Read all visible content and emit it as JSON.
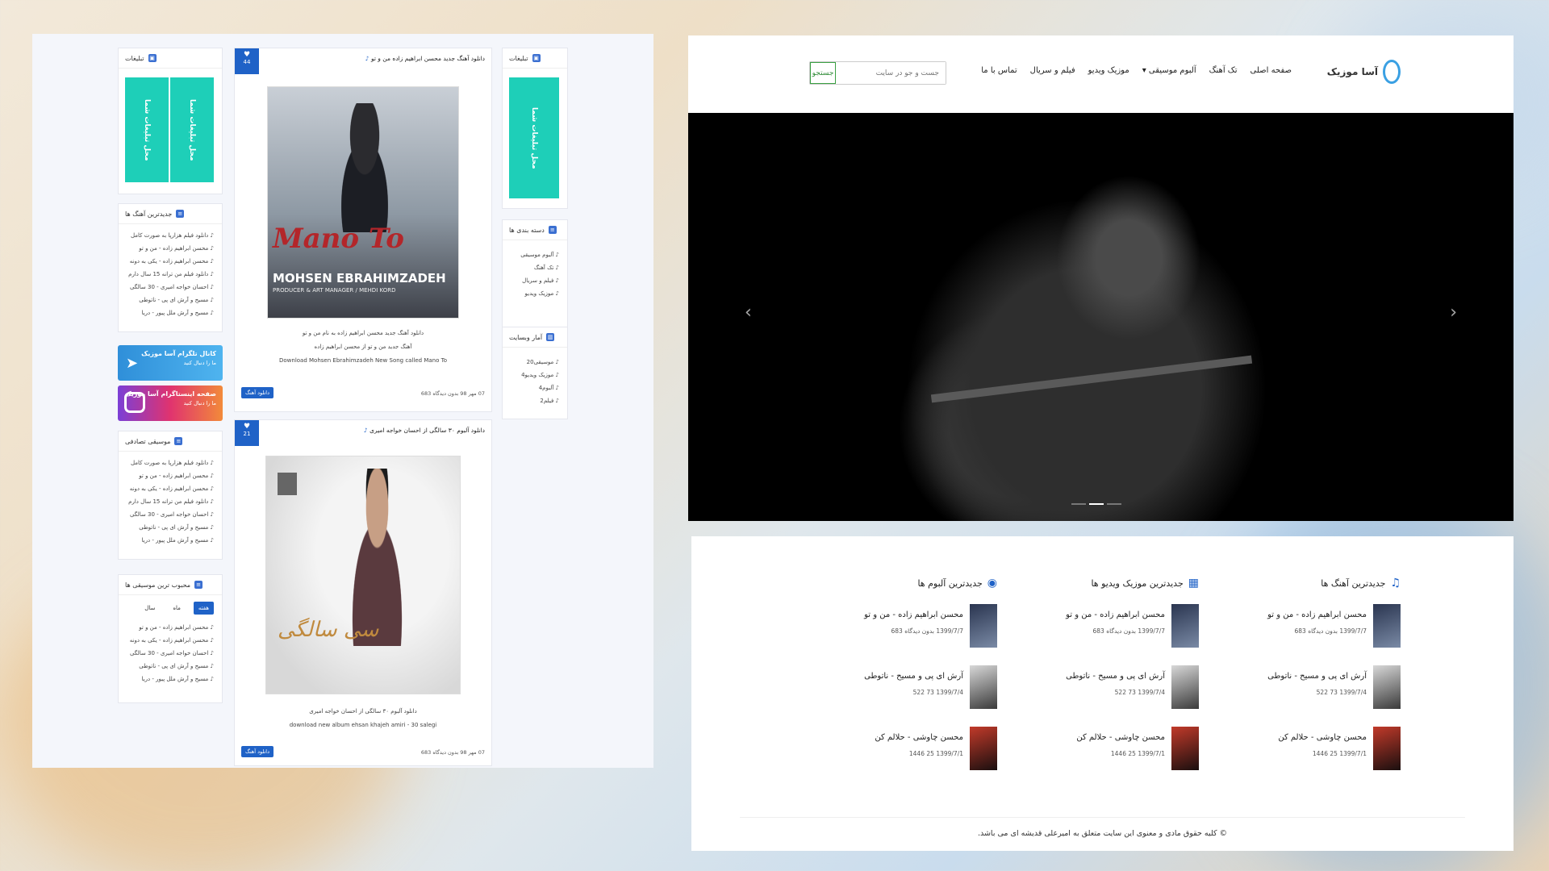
{
  "left_page": {
    "ads_title": "تبلیغات",
    "ad_text": "محل تبلیغات شما",
    "latest_songs_title": "جدیدترین آهنگ ها",
    "latest_songs": [
      "دانلود فیلم هزارپا به صورت کامل",
      "محسن ابراهیم زاده - من و تو",
      "محسن ابراهیم زاده - یکی به دونه",
      "دانلود فیلم من ترانه 15 سال دارم",
      "احسان خواجه امیری - 30 سالگی",
      "مسیح و آرش ای پی - ناتوطی",
      "مسیح و آرش ملل پیور - دریا"
    ],
    "telegram": {
      "title": "کانال تلگرام آسا موزیک",
      "sub": "ما را دنبال کنید"
    },
    "instagram": {
      "title": "صفحه اینستاگرام آسا موزیک",
      "sub": "ما را دنبال کنید"
    },
    "random_title": "موسیقی تصادفی",
    "random_songs": [
      "دانلود فیلم هزارپا به صورت کامل",
      "محسن ابراهیم زاده - من و تو",
      "محسن ابراهیم زاده - یکی به دونه",
      "دانلود فیلم من ترانه 15 سال دارم",
      "احسان خواجه امیری - 30 سالگی",
      "مسیح و آرش ای پی - ناتوطی",
      "مسیح و آرش ملل پیور - دریا"
    ],
    "popular_title": "محبوب ترین موسیقی ها",
    "popular_tabs": [
      "هفته",
      "ماه",
      "سال"
    ],
    "popular_songs": [
      "محسن ابراهیم زاده - من و تو",
      "محسن ابراهیم زاده - یکی به دونه",
      "احسان خواجه امیری - 30 سالگی",
      "مسیح و آرش ای پی - ناتوطی",
      "مسیح و آرش ملل پیور - دریا"
    ],
    "categories_title": "دسته بندی ها",
    "categories": [
      "آلبوم موسیقی",
      "تک آهنگ",
      "فیلم و سریال",
      "موزیک ویدیو"
    ],
    "stats_title": "آمار وبسایت",
    "stats": [
      "موسیقی20",
      "موزیک ویدیو4",
      "آلبوم4",
      "فیلم2"
    ],
    "posts": [
      {
        "likes": "44",
        "title": "دانلود آهنگ جدید محسن ابراهیم زاده من و تو",
        "cover_name": "Mano To",
        "cover_artist": "MOHSEN EBRAHIMZADEH",
        "cover_sub": "PRODUCER & ART MANAGER / MEHDI KORD",
        "desc1": "دانلود آهنگ جدید محسن ابراهیم زاده به نام من و تو",
        "desc2": "آهنگ جدید من و تو از محسن ابراهیم زاده",
        "desc3": "Download Mohsen Ebrahimzadeh New Song called Mano To",
        "btn": "دانلود آهنگ",
        "meta": "07 مهر 98  بدون دیدگاه  683"
      },
      {
        "likes": "21",
        "title": "دانلود آلبوم ۳۰ سالگی از احسان خواجه امیری",
        "cover_name": "سی سالگی",
        "desc1": "دانلود آلبوم ۳۰ سالگی از احسان خواجه امیری",
        "desc2": "download new album ehsan khajeh amiri - 30 salegi",
        "btn": "دانلود آهنگ",
        "meta": "07 مهر 98  بدون دیدگاه  683"
      }
    ]
  },
  "right_page": {
    "logo": "آسا موزیک",
    "nav": [
      "صفحه اصلی",
      "تک آهنگ",
      "آلبوم موسیقی ▾",
      "موزیک ویدیو",
      "فیلم و سریال",
      "تماس با ما"
    ],
    "search_placeholder": "جست و جو در سایت",
    "search_button": "جستجو",
    "columns": [
      {
        "title": "جدیدترین آهنگ ها",
        "icon": "music-note-icon",
        "items": [
          {
            "t": "محسن ابراهیم زاده - من و تو",
            "m": "1399/7/7  بدون دیدگاه  683"
          },
          {
            "t": "آرش ای پی و مسیح - ناتوطی",
            "m": "1399/7/4  73  522"
          },
          {
            "t": "محسن چاوشی - حلالم کن",
            "m": "1399/7/1  25  1446"
          }
        ]
      },
      {
        "title": "جدیدترین موزیک ویدیو ها",
        "icon": "film-icon",
        "items": [
          {
            "t": "محسن ابراهیم زاده - من و تو",
            "m": "1399/7/7  بدون دیدگاه  683"
          },
          {
            "t": "آرش ای پی و مسیح - ناتوطی",
            "m": "1399/7/4  73  522"
          },
          {
            "t": "محسن چاوشی - حلالم کن",
            "m": "1399/7/1  25  1446"
          }
        ]
      },
      {
        "title": "جدیدترین آلبوم ها",
        "icon": "album-icon",
        "items": [
          {
            "t": "محسن ابراهیم زاده - من و تو",
            "m": "1399/7/7  بدون دیدگاه  683"
          },
          {
            "t": "آرش ای پی و مسیح - ناتوطی",
            "m": "1399/7/4  73  522"
          },
          {
            "t": "محسن چاوشی - حلالم کن",
            "m": "1399/7/1  25  1446"
          }
        ]
      }
    ],
    "footer": "© کلیه حقوق مادی و معنوی این سایت متعلق به امیرعلی قدیشه ای می باشد."
  }
}
